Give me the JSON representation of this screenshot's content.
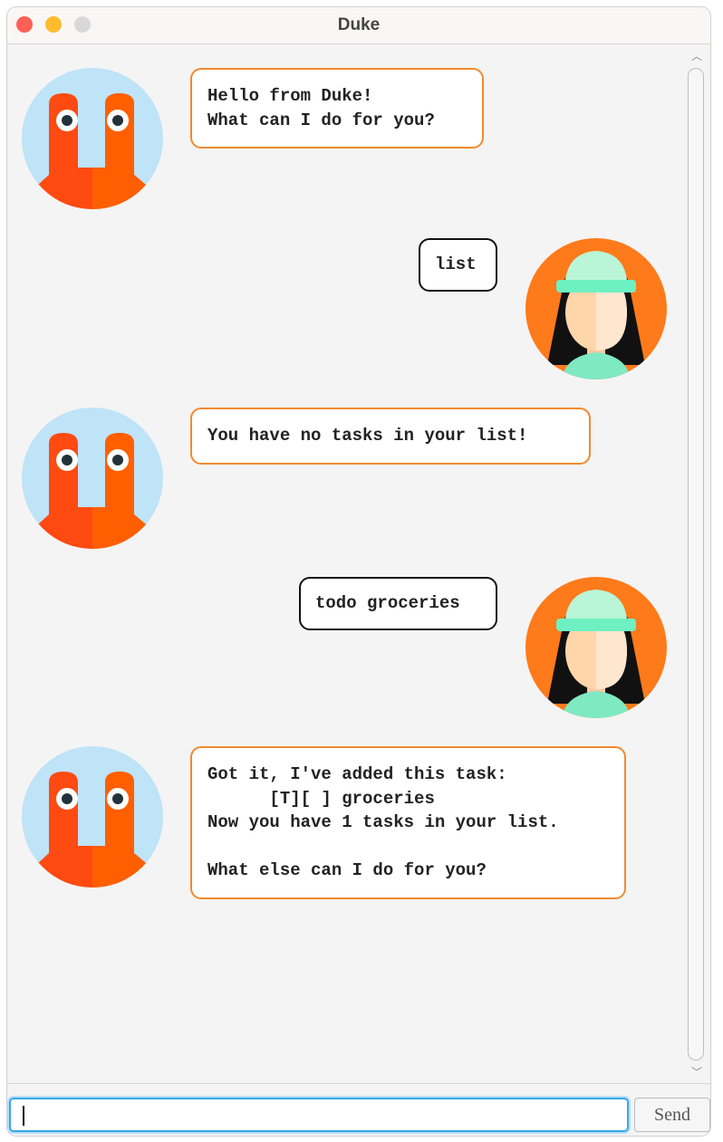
{
  "window": {
    "title": "Duke"
  },
  "messages": [
    {
      "sender": "duke",
      "text": "Hello from Duke!\nWhat can I do for you?"
    },
    {
      "sender": "user",
      "text": "list"
    },
    {
      "sender": "duke",
      "text": "You have no tasks in your list!"
    },
    {
      "sender": "user",
      "text": "todo groceries"
    },
    {
      "sender": "duke",
      "text": "Got it, I've added this task:\n      [T][ ] groceries\nNow you have 1 tasks in your list.\n\nWhat else can I do for you?"
    }
  ],
  "input": {
    "value": ""
  },
  "send_button": {
    "label": "Send"
  },
  "colors": {
    "duke_border": "#f28a2e",
    "user_border": "#111111",
    "duke_bg": "#bfe3f7",
    "duke_body": "#ff4a12",
    "user_bg": "#ff7a1a",
    "user_hat": "#a9f2d3",
    "input_focus": "#38a7e8"
  }
}
